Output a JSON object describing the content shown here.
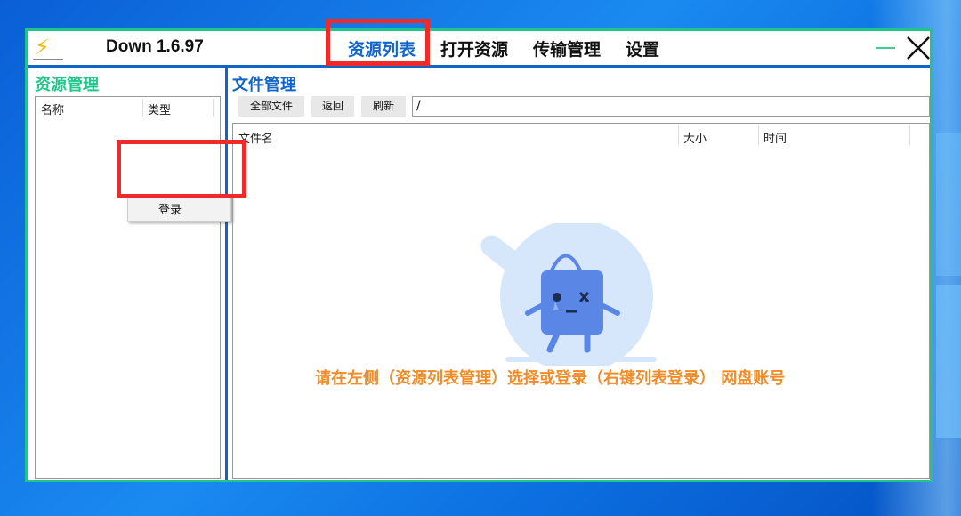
{
  "app": {
    "title": "Down 1.6.97"
  },
  "nav": [
    {
      "label": "资源列表",
      "active": true
    },
    {
      "label": "打开资源",
      "active": false
    },
    {
      "label": "传输管理",
      "active": false
    },
    {
      "label": "设置",
      "active": false
    }
  ],
  "left_panel": {
    "title": "资源管理",
    "columns": [
      "名称",
      "类型"
    ],
    "context_menu": {
      "login_label": "登录"
    }
  },
  "right_panel": {
    "title": "文件管理",
    "toolbar": {
      "all_files": "全部文件",
      "back": "返回",
      "refresh": "刷新"
    },
    "path": "/",
    "columns": [
      "文件名",
      "大小",
      "时间"
    ],
    "empty_message": "请在左侧（资源列表管理）选择或登录（右键列表登录） 网盘账号"
  },
  "icons": [
    "lightning-icon",
    "minimize-icon",
    "close-icon"
  ],
  "colors": {
    "accent_blue": "#1264c8",
    "accent_green": "#1ec68a",
    "warning_orange": "#f28c28",
    "highlight_red": "#ee2a2a"
  }
}
